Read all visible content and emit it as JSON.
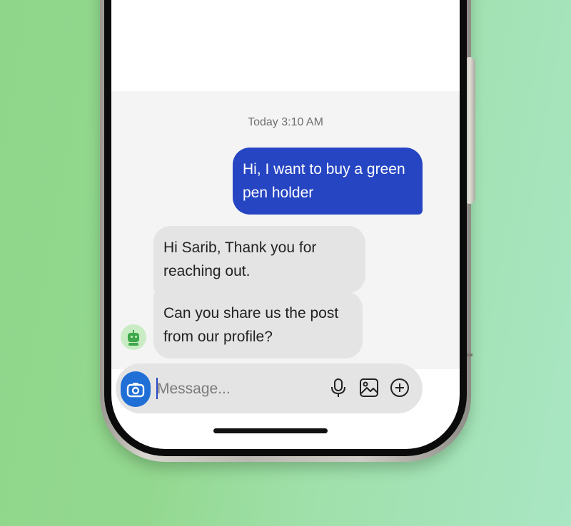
{
  "chat": {
    "timestamp": "Today 3:10 AM",
    "messages": [
      {
        "sender": "user",
        "text": "Hi, I want to buy a green pen holder"
      },
      {
        "sender": "bot",
        "text": "Hi Sarib, Thank you for reaching out."
      },
      {
        "sender": "bot",
        "text": "Can you share us the post from our profile?"
      }
    ]
  },
  "composer": {
    "placeholder": "Message...",
    "value": "",
    "icons": [
      "camera-icon",
      "microphone-icon",
      "gallery-icon",
      "plus-circle-icon"
    ]
  },
  "colors": {
    "outgoing_bubble": "#2545c2",
    "incoming_bubble": "#e4e4e4",
    "camera_button": "#1f6fd6",
    "bot_avatar": "#3fa84a"
  }
}
